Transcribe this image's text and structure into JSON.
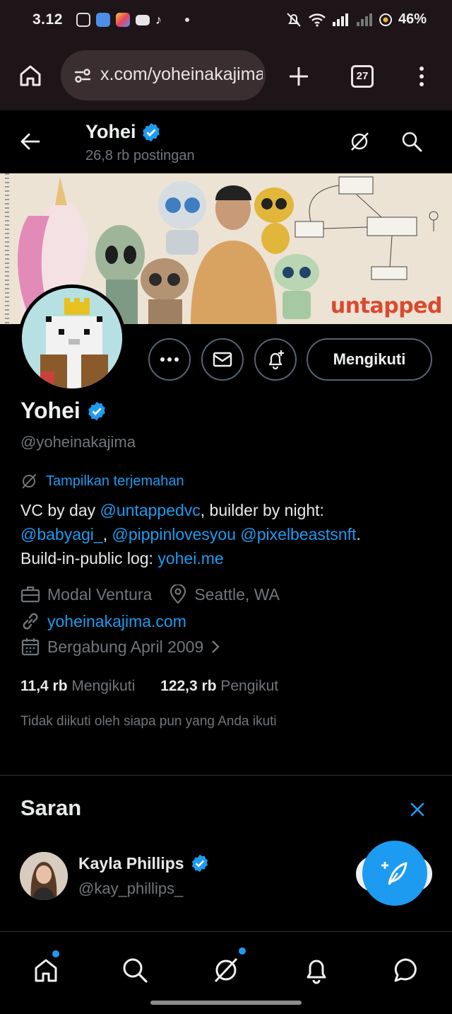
{
  "status_bar": {
    "time": "3.12",
    "battery": "46%"
  },
  "browser": {
    "url": "x.com/yoheinakajima",
    "tab_count": "27"
  },
  "header": {
    "title": "Yohei",
    "post_count": "26,8 rb postingan"
  },
  "banner": {
    "brand_text": "untapped"
  },
  "actions": {
    "follow_label": "Mengikuti"
  },
  "profile": {
    "name": "Yohei",
    "handle": "@yoheinakajima",
    "translate_label": "Tampilkan terjemahan",
    "bio": {
      "line1_text": "VC by day ",
      "line1_link": "@untappedvc",
      "line1_tail": ", builder by night:",
      "line2_link1": "@babyagi_",
      "line2_sep": ", ",
      "line2_link2": "@pippinlovesyou",
      "line2_link3": "@pixelbeastsnft",
      "line2_tail": ".",
      "line3_text": "Build-in-public log: ",
      "line3_link": "yohei.me"
    },
    "category": "Modal Ventura",
    "location": "Seattle, WA",
    "website": "yoheinakajima.com",
    "joined": "Bergabung April 2009",
    "following_count": "11,4 rb",
    "following_label": "Mengikuti",
    "followers_count": "122,3 rb",
    "followers_label": "Pengikut",
    "not_followed_text": "Tidak diikuti oleh siapa pun yang Anda ikuti"
  },
  "suggestions": {
    "title": "Saran",
    "items": [
      {
        "name": "Kayla Phillips",
        "handle": "@kay_phillips_"
      }
    ]
  },
  "colors": {
    "accent": "#1d9bf0",
    "background": "#000000",
    "secondary_text": "#71767b",
    "browser_chrome": "#1e1518"
  },
  "icons": [
    "home-icon",
    "search-icon",
    "grok-icon",
    "bell-icon",
    "message-icon",
    "back-arrow-icon",
    "verified-badge-icon",
    "more-icon",
    "mail-icon",
    "notify-bell-icon",
    "briefcase-icon",
    "location-icon",
    "link-icon",
    "calendar-icon",
    "close-icon",
    "compose-icon",
    "plus-icon",
    "tabs-icon",
    "menu-icon"
  ]
}
